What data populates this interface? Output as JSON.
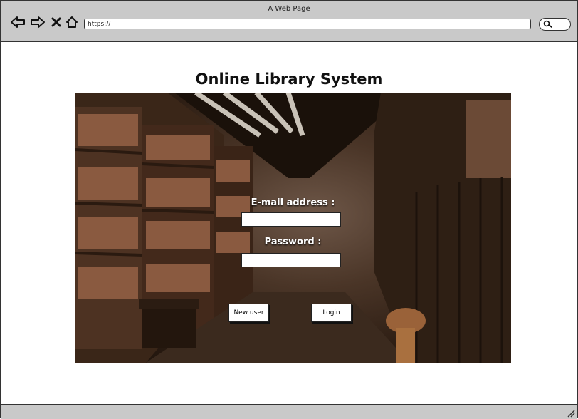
{
  "window": {
    "title": "A Web Page"
  },
  "browser": {
    "url": "https://",
    "icons": [
      "back-arrow-icon",
      "forward-arrow-icon",
      "close-icon",
      "home-icon",
      "search-icon"
    ]
  },
  "page": {
    "title": "Online Library System",
    "email_label": "E-mail address :",
    "email_value": "",
    "password_label": "Password :",
    "password_value": "",
    "new_user_label": "New user",
    "login_label": "Login"
  }
}
